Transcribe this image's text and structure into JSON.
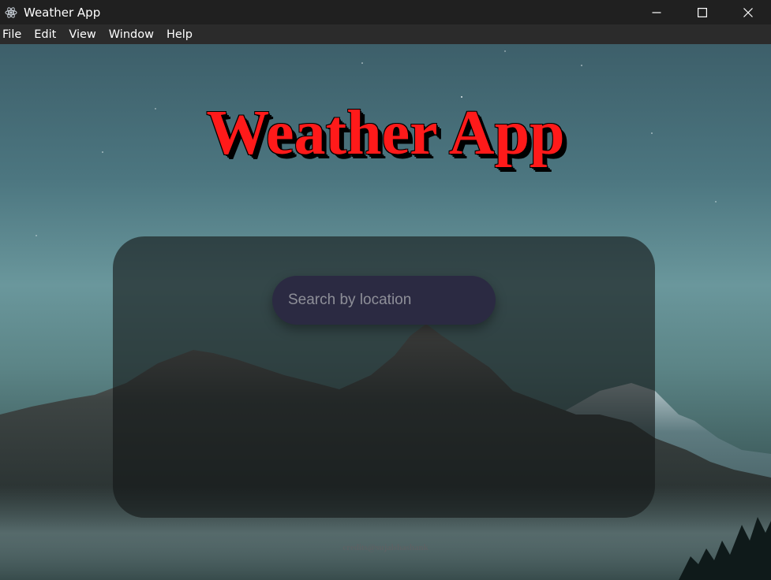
{
  "window": {
    "title": "Weather App",
    "icon": "electron-icon",
    "controls": [
      "minimize-icon",
      "maximize-icon",
      "close-icon"
    ]
  },
  "menu": {
    "items": [
      {
        "label": "File"
      },
      {
        "label": "Edit"
      },
      {
        "label": "View"
      },
      {
        "label": "Window"
      },
      {
        "label": "Help"
      }
    ]
  },
  "main": {
    "heading": "Weather App",
    "search": {
      "placeholder": "Search by location",
      "value": ""
    },
    "credits": "credits@sujalshashank"
  },
  "colors": {
    "heading": "#ff1a1a",
    "search_bg": "#2b2a42",
    "card_bg": "rgba(20,22,22,0.62)",
    "titlebar_bg": "#202020",
    "menubar_bg": "#2b2b2b"
  }
}
